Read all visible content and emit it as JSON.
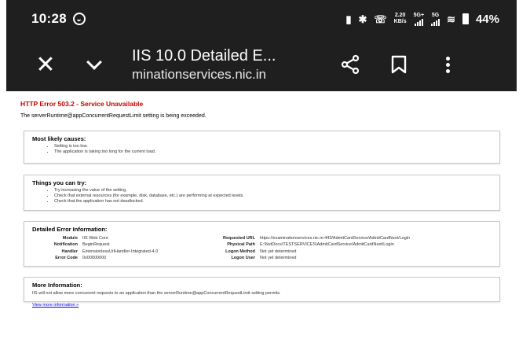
{
  "status_bar": {
    "time": "10:28",
    "speed_value": "2.20",
    "speed_unit": "KB/s",
    "net1": "5G+",
    "net2": "5G",
    "battery": "44%"
  },
  "toolbar": {
    "title": "IIS 10.0 Detailed E...",
    "url": "minationservices.nic.in"
  },
  "page": {
    "error_title": "HTTP Error 503.2 - Service Unavailable",
    "error_subtitle": "The serverRuntime@appConcurrentRequestLimit setting is being exceeded.",
    "causes": {
      "heading": "Most likely causes:",
      "items": [
        "Setting is too low.",
        "The application is taking too long for the current load."
      ]
    },
    "try": {
      "heading": "Things you can try:",
      "items": [
        "Try increasing the value of the setting.",
        "Check that external resources (for example, disk, database, etc.) are performing at expected levels.",
        "Check that the application has not deadlocked."
      ]
    },
    "details": {
      "heading": "Detailed Error Information:",
      "left": [
        {
          "key": "Module",
          "value": "IIS Web Core"
        },
        {
          "key": "Notification",
          "value": "BeginRequest"
        },
        {
          "key": "Handler",
          "value": "ExtensionlessUrlHandler-Integrated-4.0"
        },
        {
          "key": "Error Code",
          "value": "0x00000000"
        }
      ],
      "right": [
        {
          "key": "Requested URL",
          "value": "https://examinationservices.nic.in:443/AdmitCardService/AdmitCardNext/Login"
        },
        {
          "key": "Physical Path",
          "value": "E:\\NetDocs\\TESTSERVICES\\AdmitCardService\\AdmitCardNext\\Login"
        },
        {
          "key": "Logon Method",
          "value": "Not yet determined"
        },
        {
          "key": "Logon User",
          "value": "Not yet determined"
        }
      ]
    },
    "more_info": {
      "heading": "More Information:",
      "text": "IIS will not allow more concurrent requests to an application than the serverRuntime@appConcurrentRequestLimit setting permits.",
      "link": "View more information »"
    }
  },
  "icons": {
    "close": "close-icon",
    "chevron": "chevron-down-icon",
    "share": "share-icon",
    "bookmark": "bookmark-icon",
    "more": "more-vert-icon"
  }
}
